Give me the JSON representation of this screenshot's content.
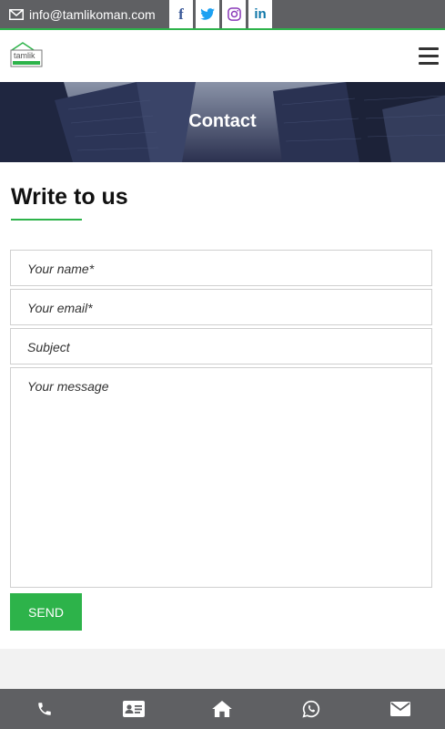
{
  "topbar": {
    "email": "info@tamlikoman.com",
    "icons": [
      "envelope-icon",
      "facebook-icon",
      "twitter-icon",
      "instagram-icon",
      "linkedin-icon"
    ],
    "social": {
      "facebook": "f",
      "twitter": "t",
      "instagram": "ig",
      "linkedin": "in"
    }
  },
  "header": {
    "logo_text": "tamlik",
    "menu_icon": "hamburger-menu-icon"
  },
  "banner": {
    "title": "Contact"
  },
  "form": {
    "heading": "Write to us",
    "name_placeholder": "Your name*",
    "email_placeholder": "Your email*",
    "subject_placeholder": "Subject",
    "message_placeholder": "Your message",
    "send_label": "SEND"
  },
  "bottom_nav": {
    "items": [
      "phone-icon",
      "contact-card-icon",
      "home-icon",
      "whatsapp-icon",
      "envelope-icon"
    ]
  },
  "colors": {
    "accent": "#2db34a",
    "topbar_bg": "#5f6063",
    "band_bg": "#f2f2f2"
  }
}
